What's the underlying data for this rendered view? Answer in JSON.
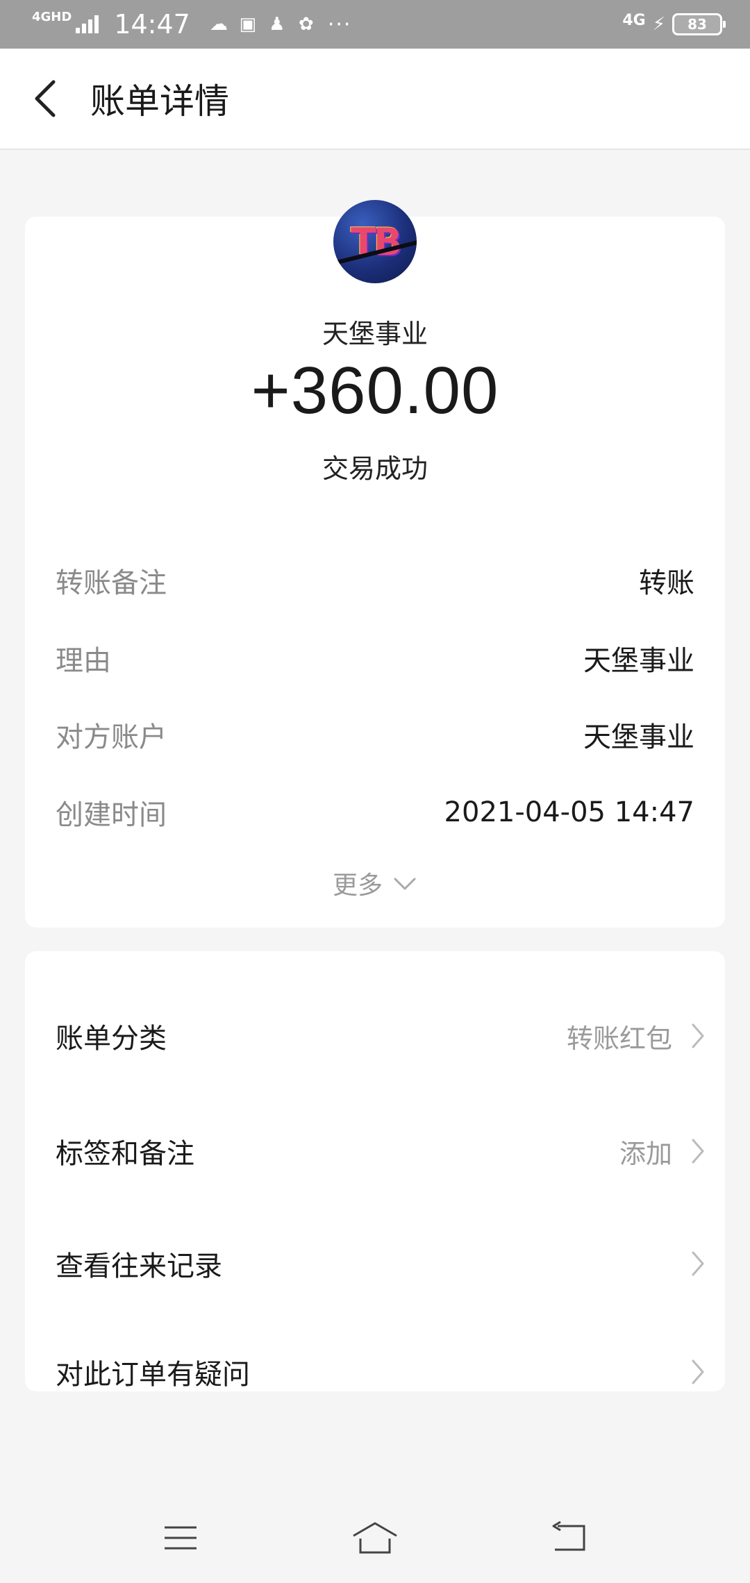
{
  "status_bar": {
    "network_badge": "4GHD",
    "time": "14:47",
    "network_right": "4G",
    "battery": "83",
    "colors": {
      "background": "#9e9e9e"
    }
  },
  "header": {
    "title": "账单详情",
    "back_icon": "chevron-left-icon"
  },
  "transaction": {
    "payee": "天堡事业",
    "avatar_text": "TB",
    "amount": "+360.00",
    "status": "交易成功",
    "details": [
      {
        "label": "转账备注",
        "value": "转账"
      },
      {
        "label": "理由",
        "value": "天堡事业"
      },
      {
        "label": "对方账户",
        "value": "天堡事业"
      },
      {
        "label": "创建时间",
        "value": "2021-04-05 14:47"
      }
    ],
    "more_label": "更多"
  },
  "menu": {
    "items": [
      {
        "label": "账单分类",
        "value": "转账红包"
      },
      {
        "label": "标签和备注",
        "value": "添加"
      },
      {
        "label": "查看往来记录",
        "value": ""
      },
      {
        "label": "对此订单有疑问",
        "value": ""
      }
    ]
  },
  "nav": {
    "icons": [
      "menu-icon",
      "home-icon",
      "back-icon"
    ]
  }
}
